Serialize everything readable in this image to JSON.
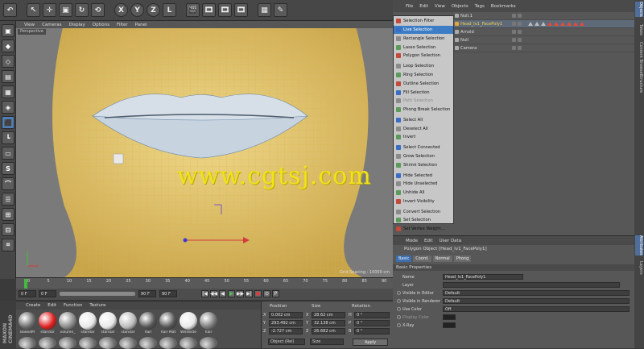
{
  "toolbar": {
    "buttons": [
      "↶",
      "↖",
      "✛",
      "▣",
      "↻",
      "⟲",
      "X",
      "Y",
      "Z",
      "L",
      "🎬",
      "🎞",
      "🎞",
      "🎞",
      "▦",
      "✎"
    ]
  },
  "viewport": {
    "menu": [
      "View",
      "Cameras",
      "Display",
      "Options",
      "Filter",
      "Panel"
    ],
    "tab": "Perspective",
    "grid_spacing": "Grid Spacing : 10000 cm",
    "watermark": "www.cgtsj.com"
  },
  "object_manager": {
    "menu": [
      "File",
      "Edit",
      "View",
      "Objects",
      "Tags",
      "Bookmarks"
    ],
    "objects": [
      {
        "name": "Null.1",
        "selected": false
      },
      {
        "name": "Head_lv1_FacePoly1",
        "selected": true
      },
      {
        "name": "Arnold",
        "selected": false
      },
      {
        "name": "Null",
        "selected": false
      },
      {
        "name": "Camera",
        "selected": false
      }
    ]
  },
  "selection_menu": {
    "items": [
      {
        "label": "Selection Filter",
        "state": "normal"
      },
      {
        "label": "Live Selection",
        "state": "active"
      },
      {
        "label": "Rectangle Selection",
        "state": "normal"
      },
      {
        "label": "Lasso Selection",
        "state": "normal"
      },
      {
        "label": "Polygon Selection",
        "state": "normal"
      },
      {
        "label": "",
        "state": "separator"
      },
      {
        "label": "Loop Selection",
        "state": "normal"
      },
      {
        "label": "Ring Selection",
        "state": "normal"
      },
      {
        "label": "Outline Selection",
        "state": "normal"
      },
      {
        "label": "Fill Selection",
        "state": "normal"
      },
      {
        "label": "Path Selection",
        "state": "disabled"
      },
      {
        "label": "Phong Break Selection",
        "state": "normal"
      },
      {
        "label": "",
        "state": "separator"
      },
      {
        "label": "Select All",
        "state": "normal"
      },
      {
        "label": "Deselect All",
        "state": "normal"
      },
      {
        "label": "Invert",
        "state": "normal"
      },
      {
        "label": "",
        "state": "separator"
      },
      {
        "label": "Select Connected",
        "state": "normal"
      },
      {
        "label": "Grow Selection",
        "state": "normal"
      },
      {
        "label": "Shrink Selection",
        "state": "normal"
      },
      {
        "label": "",
        "state": "separator"
      },
      {
        "label": "Hide Selected",
        "state": "normal"
      },
      {
        "label": "Hide Unselected",
        "state": "normal"
      },
      {
        "label": "Unhide All",
        "state": "normal"
      },
      {
        "label": "Invert Visibility",
        "state": "normal"
      },
      {
        "label": "",
        "state": "separator"
      },
      {
        "label": "Convert Selection",
        "state": "normal"
      },
      {
        "label": "Set Selection",
        "state": "normal"
      },
      {
        "label": "Set Vertex Weight...",
        "state": "normal"
      }
    ]
  },
  "right_tabs": [
    "Objects",
    "Takes",
    "Content Browser",
    "Structure",
    "Attributes",
    "Layers"
  ],
  "attribute_manager": {
    "menu": [
      "Mode",
      "Edit",
      "User Data"
    ],
    "title": "Polygon Object [Head_lv1_FacePoly1]",
    "tabs": [
      {
        "label": "Basic",
        "active": true
      },
      {
        "label": "Coord.",
        "active": false
      },
      {
        "label": "Normal",
        "active": false
      },
      {
        "label": "Phong",
        "active": false
      }
    ],
    "section": "Basic Properties",
    "props": [
      {
        "label": "Name",
        "value": "Head_lv1_FacePoly1",
        "radio": false
      },
      {
        "label": "Layer",
        "value": "",
        "radio": false
      },
      {
        "label": "Visible in Editor",
        "value": "Default",
        "radio": true
      },
      {
        "label": "Visible in Renderer",
        "value": "Default",
        "radio": true
      },
      {
        "label": "Use Color",
        "value": "Off",
        "radio": true
      },
      {
        "label": "Display Color",
        "value": "",
        "radio": true
      },
      {
        "label": "X-Ray",
        "value": "",
        "radio": true
      }
    ]
  },
  "timeline": {
    "ticks": [
      "0",
      "5",
      "10",
      "15",
      "20",
      "25",
      "30",
      "35",
      "40",
      "45",
      "50",
      "55",
      "60",
      "65",
      "70",
      "75",
      "80",
      "85",
      "90"
    ],
    "frame_start": "0 F",
    "frame_current": "0 F",
    "frame_end_a": "90 F",
    "frame_end_b": "90 F",
    "progress": 0
  },
  "transport": {
    "buttons": [
      "|◀",
      "◀◀",
      "◀",
      "▶",
      "▶▶",
      "▶|",
      "●",
      "⊙",
      "P"
    ]
  },
  "material_manager": {
    "menu": [
      "Create",
      "Edit",
      "Function",
      "Texture"
    ],
    "materials": [
      {
        "label": "BakedM",
        "color": "#6b6b6b"
      },
      {
        "label": "standar",
        "color": "#e02020"
      },
      {
        "label": "volume_",
        "color": "#8a8a8a"
      },
      {
        "label": "standar",
        "color": "#e8e8e8"
      },
      {
        "label": "standar",
        "color": "#e8e8e8"
      },
      {
        "label": "standar",
        "color": "#bcbcbc"
      },
      {
        "label": "hair",
        "color": "#555555"
      },
      {
        "label": "hair Mat",
        "color": "#555555"
      },
      {
        "label": "Whiteste",
        "color": "#e8e8e8"
      },
      {
        "label": "hair",
        "color": "#7a7a7a"
      }
    ],
    "brand": "MAXON CINEMA4D"
  },
  "coordinates": {
    "headers": [
      "Position",
      "Size",
      "Rotation"
    ],
    "rows": [
      {
        "axis": "X",
        "pos": "0.002 cm",
        "size_axis": "X",
        "size": "28.62 cm",
        "rot_axis": "H",
        "rot": "0 °"
      },
      {
        "axis": "Y",
        "pos": "293.492 cm",
        "size_axis": "Y",
        "size": "32.138 cm",
        "rot_axis": "P",
        "rot": "0 °"
      },
      {
        "axis": "Z",
        "pos": "-2.727 cm",
        "size_axis": "Z",
        "size": "26.682 cm",
        "rot_axis": "B",
        "rot": "0 °"
      }
    ],
    "mode": "Object (Rel)",
    "size_mode": "Size",
    "apply": "Apply"
  },
  "colors": {
    "accent": "#3d7dc6",
    "watermark": "#f1e318",
    "mesh_wire": "#d9b24a"
  }
}
